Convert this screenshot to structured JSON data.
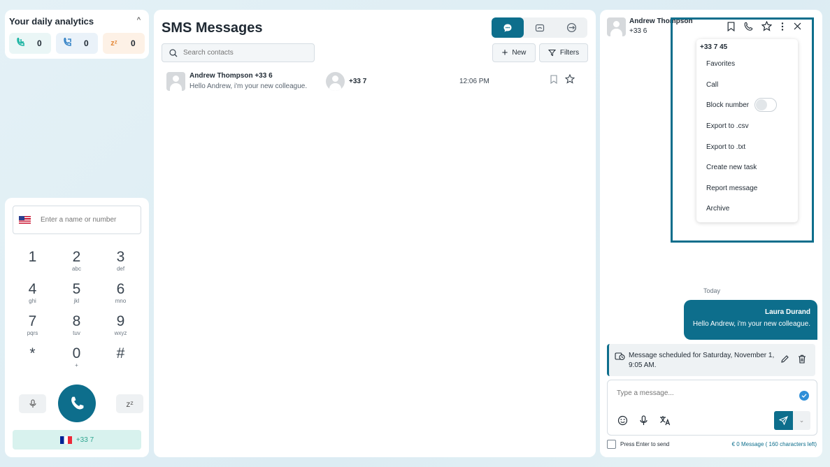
{
  "analytics": {
    "title": "Your daily analytics",
    "cards": [
      {
        "icon": "incoming-call-icon",
        "value": "0"
      },
      {
        "icon": "outgoing-call-icon",
        "value": "0"
      },
      {
        "icon": "snooze-icon",
        "glyph": "zᶻ",
        "value": "0"
      }
    ]
  },
  "dialer": {
    "placeholder": "Enter a name or number",
    "keys": [
      {
        "d": "1",
        "l": ""
      },
      {
        "d": "2",
        "l": "abc"
      },
      {
        "d": "3",
        "l": "def"
      },
      {
        "d": "4",
        "l": "ghi"
      },
      {
        "d": "5",
        "l": "jkl"
      },
      {
        "d": "6",
        "l": "mno"
      },
      {
        "d": "7",
        "l": "pqrs"
      },
      {
        "d": "8",
        "l": "tuv"
      },
      {
        "d": "9",
        "l": "wxyz"
      },
      {
        "d": "*",
        "l": ""
      },
      {
        "d": "0",
        "l": "+"
      },
      {
        "d": "#",
        "l": ""
      }
    ],
    "snooze_glyph": "zᶻ",
    "caller_id": "+33 7"
  },
  "sms": {
    "title": "SMS Messages",
    "search_placeholder": "Search contacts",
    "new_label": "New",
    "filters_label": "Filters",
    "conversations": [
      {
        "name": "Andrew Thompson +33 6",
        "message": "Hello Andrew, i'm your new colleague.",
        "number": "+33 7",
        "time": "12:06 PM"
      }
    ]
  },
  "chat": {
    "contact_name": "Andrew Thompson",
    "contact_number": "+33 6",
    "menu": {
      "header": "+33 7 45",
      "items": [
        "Favorites",
        "Call",
        "Block number",
        "Export to .csv",
        "Export to .txt",
        "Create new task",
        "Report message",
        "Archive"
      ]
    },
    "day_label": "Today",
    "message": {
      "sender": "Laura Durand",
      "text": "Hello Andrew, i'm your new colleague."
    },
    "scheduled": "Message scheduled for Saturday, November 1, 9:05 AM.",
    "compose_placeholder": "Type a message...",
    "press_enter": "Press Enter to send",
    "counter": "€ 0 Message ( 160 characters left)"
  },
  "colors": {
    "primary": "#0d6e8c",
    "accent_blue": "#2f8fd8",
    "caller_green": "#2ea58f"
  }
}
